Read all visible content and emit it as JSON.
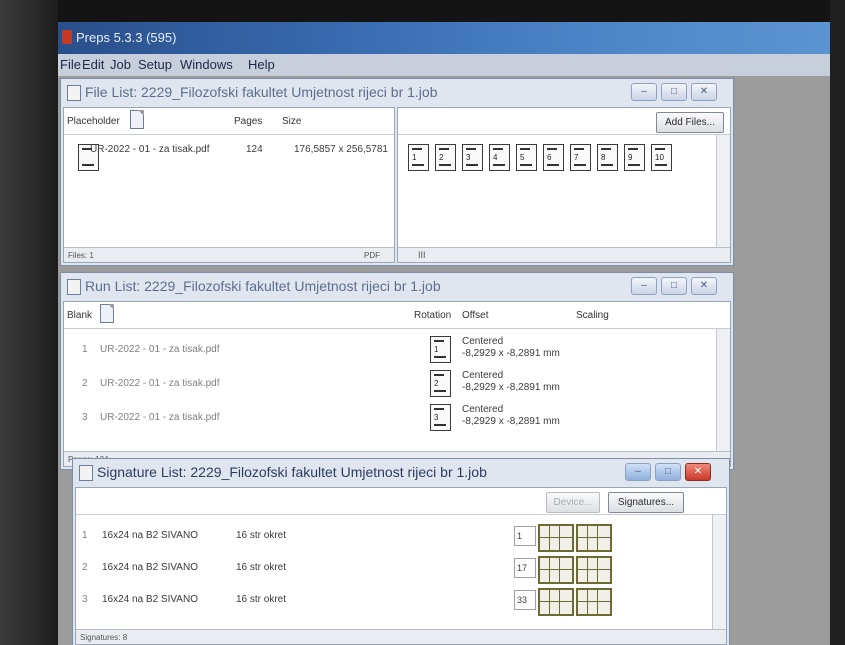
{
  "app": {
    "title": "Preps 5.3.3 (595)"
  },
  "menu": [
    "File",
    "Edit",
    "Job",
    "Setup",
    "Windows",
    "Help"
  ],
  "file_list": {
    "title": "File List:  2229_Filozofski fakultet Umjetnost rijeci br 1.job",
    "col_placeholder": "Placeholder",
    "col_pages": "Pages",
    "col_size": "Size",
    "add_files": "Add Files...",
    "file_name": "UR-2022 - 01 - za tisak.pdf",
    "file_pages": "124",
    "file_size": "176,5857 x 256,5781",
    "status_files": "Files: 1",
    "status_pdf": "PDF",
    "scroll_mark": "III",
    "thumb_pages": [
      "1",
      "2",
      "3",
      "4",
      "5",
      "6",
      "7",
      "8",
      "9",
      "10"
    ]
  },
  "run_list": {
    "title": "Run List:  2229_Filozofski fakultet Umjetnost rijeci br 1.job",
    "col_blank": "Blank",
    "col_rotation": "Rotation",
    "col_offset": "Offset",
    "col_scaling": "Scaling",
    "rows": [
      {
        "num": "1",
        "file": "UR-2022 - 01 - za tisak.pdf",
        "page": "1",
        "offset_mode": "Centered",
        "offset_value": "-8,2929 x -8,2891 mm"
      },
      {
        "num": "2",
        "file": "UR-2022 - 01 - za tisak.pdf",
        "page": "2",
        "offset_mode": "Centered",
        "offset_value": "-8,2929 x -8,2891 mm"
      },
      {
        "num": "3",
        "file": "UR-2022 - 01 - za tisak.pdf",
        "page": "3",
        "offset_mode": "Centered",
        "offset_value": "-8,2929 x -8,2891 mm"
      }
    ],
    "status_pages": "Pages: 124"
  },
  "signature_list": {
    "title": "Signature List:  2229_Filozofski fakultet Umjetnost rijeci br 1.job",
    "device_btn": "Device...",
    "signatures_btn": "Signatures...",
    "rows": [
      {
        "num": "1",
        "name": "16x24 na B2 SIVANO",
        "type": "16 str okret",
        "start": "1"
      },
      {
        "num": "2",
        "name": "16x24 na B2 SIVANO",
        "type": "16 str okret",
        "start": "17"
      },
      {
        "num": "3",
        "name": "16x24 na B2 SIVANO",
        "type": "16 str okret",
        "start": "33"
      }
    ],
    "status_signatures": "Signatures: 8"
  },
  "colors": {
    "titlebar": "#3a6db3",
    "window_bg": "#dfe6ef",
    "close_red": "#c8382a"
  }
}
